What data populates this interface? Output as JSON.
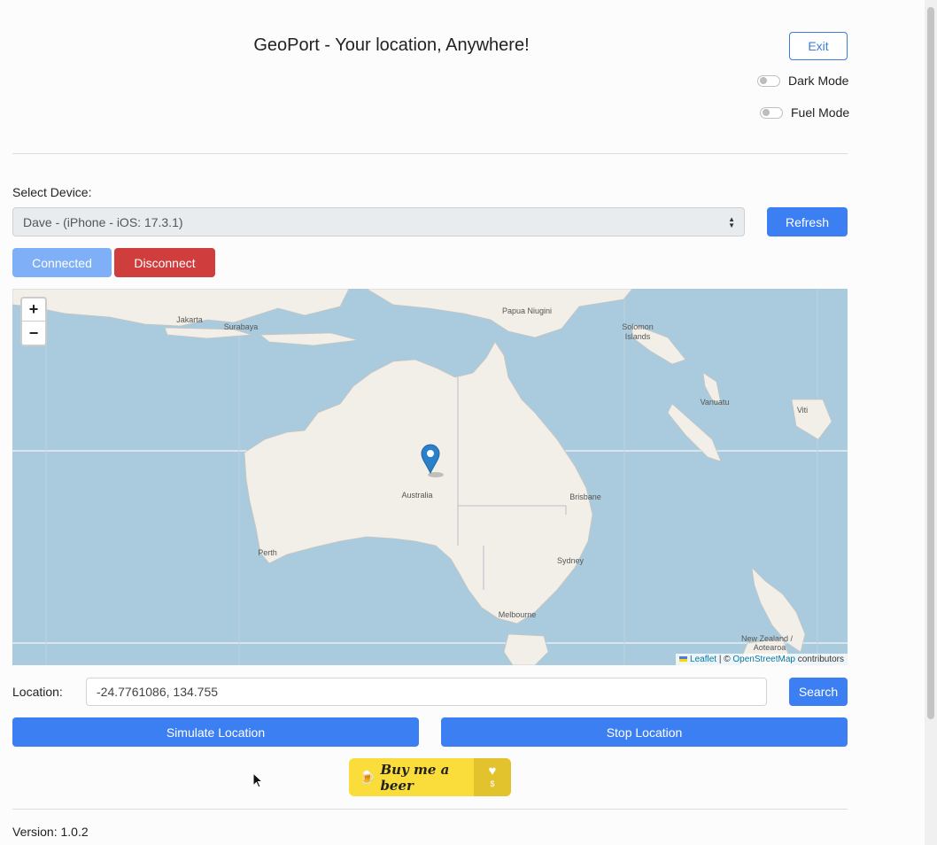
{
  "header": {
    "title": "GeoPort - Your location, Anywhere!",
    "exit_label": "Exit"
  },
  "toggles": [
    {
      "label": "Dark Mode",
      "on": false
    },
    {
      "label": "Fuel Mode",
      "on": false
    }
  ],
  "device": {
    "label": "Select Device:",
    "selected": "Dave - (iPhone - iOS: 17.3.1)",
    "refresh_label": "Refresh",
    "connected_label": "Connected",
    "disconnect_label": "Disconnect"
  },
  "map": {
    "zoom_in": "+",
    "zoom_out": "−",
    "places": {
      "jakarta": "Jakarta",
      "surabaya": "Surabaya",
      "papua": "Papua Niugini",
      "solomon1": "Solomon",
      "solomon2": "Islands",
      "vanuatu": "Vanuatu",
      "fiji": "Viti",
      "australia": "Australia",
      "brisbane": "Brisbane",
      "perth": "Perth",
      "sydney": "Sydney",
      "melbourne": "Melbourne",
      "nz1": "New Zealand /",
      "nz2": "Aotearoa"
    },
    "attribution": {
      "leaflet": "Leaflet",
      "sep": "| ©",
      "osm": "OpenStreetMap",
      "suffix": "contributors"
    },
    "colors": {
      "water": "#aacbdd",
      "land": "#f2efe9"
    }
  },
  "location": {
    "label": "Location:",
    "value": "-24.7761086, 134.755",
    "search_label": "Search",
    "simulate_label": "Simulate Location",
    "stop_label": "Stop Location"
  },
  "donate": {
    "label": "Buy me a beer",
    "icon": "beer-mug-icon",
    "heart_icon": "heart-icon"
  },
  "footer": {
    "version": "Version: 1.0.2"
  },
  "colors": {
    "primary": "#3b7ff2",
    "danger": "#cf3d3d",
    "connected": "#7fb0f7",
    "beer": "#fadd3b"
  }
}
